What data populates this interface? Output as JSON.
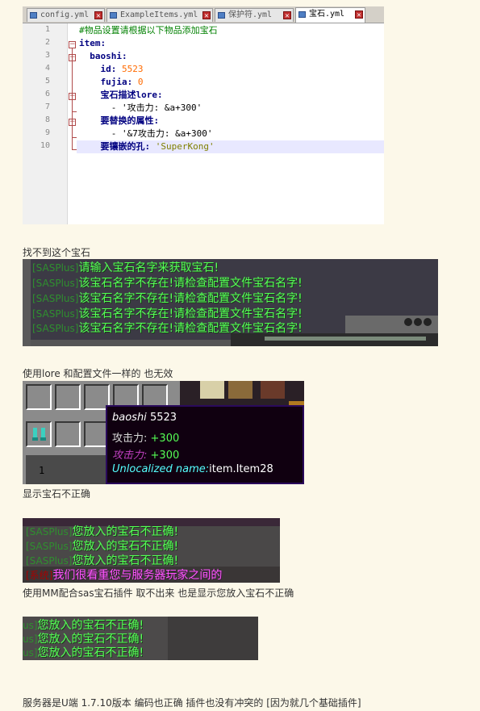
{
  "editor": {
    "tabs": [
      {
        "label": "config.yml",
        "active": false
      },
      {
        "label": "ExampleItems.yml",
        "active": false
      },
      {
        "label": "保护符.yml",
        "active": false
      },
      {
        "label": "宝石.yml",
        "active": true
      }
    ],
    "close_glyph": "✕",
    "line_numbers": [
      "1",
      "2",
      "3",
      "4",
      "5",
      "6",
      "7",
      "8",
      "9",
      "10"
    ],
    "lines": [
      {
        "indent": "",
        "parts": [
          {
            "t": "#物品设置请根据以下物品添加宝石",
            "c": "comment"
          }
        ]
      },
      {
        "indent": "",
        "parts": [
          {
            "t": "item:",
            "c": "key"
          }
        ]
      },
      {
        "indent": "  ",
        "parts": [
          {
            "t": "baoshi:",
            "c": "key"
          }
        ]
      },
      {
        "indent": "    ",
        "parts": [
          {
            "t": "id: ",
            "c": "key"
          },
          {
            "t": "5523",
            "c": "num"
          }
        ]
      },
      {
        "indent": "    ",
        "parts": [
          {
            "t": "fujia: ",
            "c": "key"
          },
          {
            "t": "0",
            "c": "num"
          }
        ]
      },
      {
        "indent": "    ",
        "parts": [
          {
            "t": "宝石描述lore:",
            "c": "key"
          }
        ]
      },
      {
        "indent": "      ",
        "parts": [
          {
            "t": "- '攻击力: &a+300'",
            "c": "plain"
          }
        ]
      },
      {
        "indent": "    ",
        "parts": [
          {
            "t": "要替换的属性:",
            "c": "key"
          }
        ]
      },
      {
        "indent": "      ",
        "parts": [
          {
            "t": "- '&7攻击力: &a+300'",
            "c": "plain"
          }
        ]
      },
      {
        "indent": "    ",
        "parts": [
          {
            "t": "要镶嵌的孔: ",
            "c": "key"
          },
          {
            "t": "'SuperKong'",
            "c": "str"
          }
        ]
      }
    ]
  },
  "captions": {
    "c1": "找不到这个宝石",
    "c2": "使用lore 和配置文件一样的 也无效",
    "c3": "显示宝石不正确",
    "c4": "使用MM配合sas宝石插件 取不出来 也是显示您放入宝石不正确",
    "c5": "服务器是U端 1.7.10版本 编码也正确 插件也没有冲突的 [因为就几个基础插件]"
  },
  "chat1": {
    "lines": [
      {
        "tag": "[SASPlus]",
        "msg": "请输入宝石名字来获取宝石!"
      },
      {
        "tag": "[SASPlus]",
        "msg": "该宝石名字不存在!请检查配置文件宝石名字!"
      },
      {
        "tag": "[SASPlus]",
        "msg": "该宝石名字不存在!请检查配置文件宝石名字!"
      },
      {
        "tag": "[SASPlus]",
        "msg": "该宝石名字不存在!请检查配置文件宝石名字!"
      },
      {
        "tag": "[SASPlus]",
        "msg": "该宝石名字不存在!请检查配置文件宝石名字!"
      }
    ]
  },
  "tooltip": {
    "name": "baoshi",
    "id": "5523",
    "line1_label": "攻击力:",
    "line1_value": "+300",
    "line2_label": "攻击力:",
    "line2_value": "+300",
    "unlocalized_label": "Unlocalized name:",
    "unlocalized_value": "item.Item28",
    "hotbar_number": "1"
  },
  "chat2": {
    "lines": [
      {
        "tag": "[SASPlus]",
        "msg": "您放入的宝石不正确!",
        "sys": false
      },
      {
        "tag": "[SASPlus]",
        "msg": "您放入的宝石不正确!",
        "sys": false
      },
      {
        "tag": "[SASPlus]",
        "msg": "您放入的宝石不正确!",
        "sys": false
      },
      {
        "tag": "[系统]",
        "msg": "我们很看重您与服务器玩家之间的",
        "sys": true
      }
    ]
  },
  "chat3": {
    "lines": [
      {
        "tag": "us]",
        "msg": "您放入的宝石不正确!"
      },
      {
        "tag": "us]",
        "msg": "您放入的宝石不正确!"
      },
      {
        "tag": "us]",
        "msg": "您放入的宝石不正确!"
      }
    ]
  },
  "colors": {
    "page_bg": "#fcf8e9",
    "chat_green": "#55ff55",
    "chat_pink": "#ff55ff",
    "yaml_key": "#000080",
    "yaml_comment": "#008000",
    "yaml_number": "#ff6a00"
  }
}
